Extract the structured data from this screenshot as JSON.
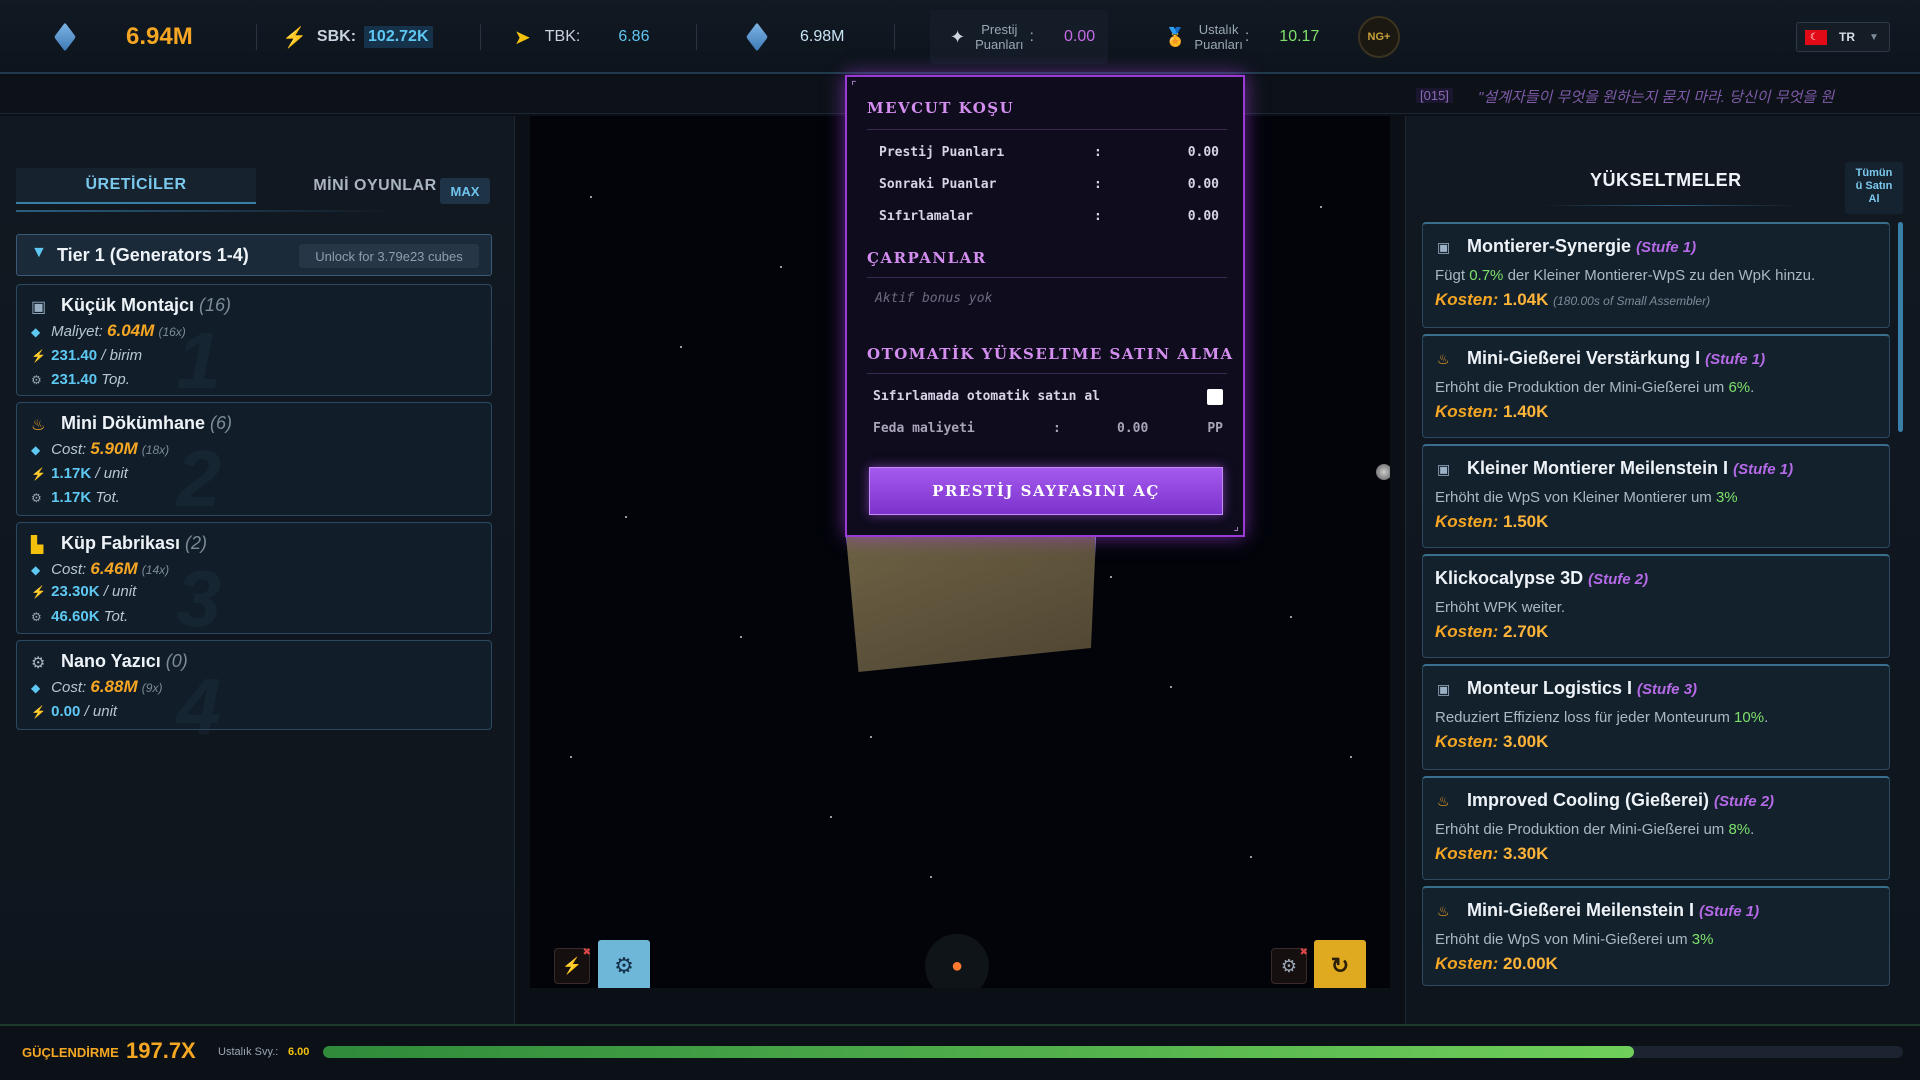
{
  "topbar": {
    "cubes": "6.94M",
    "sbk_label": "SBK:",
    "sbk_value": "102.72K",
    "tbk_label": "TBK:",
    "tbk_value": "6.86",
    "total_cubes": "6.98M",
    "prestige_label_1": "Prestij",
    "prestige_label_2": "Puanları",
    "prestige_colon": ":",
    "prestige_value": "0.00",
    "mastery_label_1": "Ustalık",
    "mastery_label_2": "Puanları",
    "mastery_colon": ":",
    "mastery_value": "10.17",
    "ng_badge": "NG+",
    "language": "TR",
    "colors": {
      "accent_orange": "#f5a623",
      "accent_cyan": "#5ec8f2",
      "accent_green": "#7ee06a",
      "accent_purple": "#b66ae8"
    }
  },
  "ticker": {
    "code": "[015]",
    "text": "\"설계자들이 무엇을 원하는지 묻지 마라. 당신이 무엇을 원"
  },
  "left": {
    "tabs": [
      {
        "label": "ÜRETİCİLER",
        "active": true
      },
      {
        "label": "MİNİ OYUNLAR",
        "active": false
      }
    ],
    "max_button": "MAX",
    "tier": {
      "label": "Tier 1 (Generators 1-4)",
      "unlock": "Unlock for 3.79e23 cubes"
    },
    "generators": [
      {
        "name": "Küçük Montajcı",
        "count": "(16)",
        "cost_label": "Maliyet:",
        "cost": "6.04M",
        "mult": "(16x)",
        "rate": "231.40",
        "rate_unit": "/ birim",
        "total": "231.40",
        "total_unit": "Top.",
        "bignum": "1"
      },
      {
        "name": "Mini Dökümhane",
        "count": "(6)",
        "cost_label": "Cost:",
        "cost": "5.90M",
        "mult": "(18x)",
        "rate": "1.17K",
        "rate_unit": "/ unit",
        "total": "1.17K",
        "total_unit": "Tot.",
        "bignum": "2"
      },
      {
        "name": "Küp Fabrikası",
        "count": "(2)",
        "cost_label": "Cost:",
        "cost": "6.46M",
        "mult": "(14x)",
        "rate": "23.30K",
        "rate_unit": "/ unit",
        "total": "46.60K",
        "total_unit": "Tot.",
        "bignum": "3"
      },
      {
        "name": "Nano Yazıcı",
        "count": "(0)",
        "cost_label": "Cost:",
        "cost": "6.88M",
        "mult": "(9x)",
        "rate": "0.00",
        "rate_unit": "/ unit",
        "bignum": "4"
      }
    ]
  },
  "modal": {
    "current_run_title": "MEVCUT KOŞU",
    "rows": [
      {
        "label": "Prestij Puanları",
        "colon": ":",
        "value": "0.00"
      },
      {
        "label": "Sonraki Puanlar",
        "colon": ":",
        "value": "0.00"
      },
      {
        "label": "Sıfırlamalar",
        "colon": ":",
        "value": "0.00"
      }
    ],
    "multipliers_title": "ÇARPANLAR",
    "no_bonus": "Aktif bonus yok",
    "auto_title": "OTOMATİK YÜKSELTME SATIN ALMA",
    "auto_label": "Sıfırlamada otomatik satın al",
    "sacrifice_label": "Feda maliyeti",
    "sacrifice_colon": ":",
    "sacrifice_value": "0.00",
    "sacrifice_unit": "PP",
    "open_button": "PRESTİJ SAYFASINI AÇ"
  },
  "right": {
    "title": "YÜKSELTMELER",
    "buy_all": [
      "Tümün",
      "ü Satın",
      "Al"
    ],
    "upgrades": [
      {
        "name": "Montierer-Synergie",
        "stage": "(Stufe 1)",
        "desc_pre": "Fügt",
        "desc_hl": "0.7%",
        "desc_post": "der Kleiner Montierer-WpS zu den WpK hinzu.",
        "cost_label": "Kosten:",
        "cost": "1.04K",
        "cost_note": "(180.00s of Small Assembler)",
        "icon": "monitor-icon"
      },
      {
        "name": "Mini-Gießerei Verstärkung I",
        "stage": "(Stufe 1)",
        "desc_pre": "Erhöht die Produktion der Mini-Gießerei um",
        "desc_hl": "6%",
        "desc_post": ".",
        "cost_label": "Kosten:",
        "cost": "1.40K",
        "icon": "flask-icon"
      },
      {
        "name": "Kleiner Montierer Meilenstein I",
        "stage": "(Stufe 1)",
        "desc_pre": "Erhöht die WpS von Kleiner Montierer um",
        "desc_hl": "3%",
        "desc_post": "",
        "cost_label": "Kosten:",
        "cost": "1.50K",
        "icon": "monitor-icon"
      },
      {
        "name": "Klickocalypse 3D",
        "stage": "(Stufe 2)",
        "desc_pre": "Erhöht WPK weiter.",
        "desc_hl": "",
        "desc_post": "",
        "cost_label": "Kosten:",
        "cost": "2.70K",
        "icon": ""
      },
      {
        "name": "Monteur Logistics I",
        "stage": "(Stufe 3)",
        "desc_pre": "Reduziert Effizienz loss für jeder Monteurum",
        "desc_hl": "10%",
        "desc_post": ".",
        "cost_label": "Kosten:",
        "cost": "3.00K",
        "icon": "monitor-icon"
      },
      {
        "name": "Improved Cooling (Gießerei)",
        "stage": "(Stufe 2)",
        "desc_pre": "Erhöht die Produktion der Mini-Gießerei um",
        "desc_hl": "8%",
        "desc_post": ".",
        "cost_label": "Kosten:",
        "cost": "3.30K",
        "icon": "flask-icon"
      },
      {
        "name": "Mini-Gießerei Meilenstein I",
        "stage": "(Stufe 1)",
        "desc_pre": "Erhöht die WpS von Mini-Gießerei um",
        "desc_hl": "3%",
        "desc_post": "",
        "cost_label": "Kosten:",
        "cost": "20.00K",
        "icon": "flask-icon"
      }
    ]
  },
  "bottom": {
    "boost_label": "GÜÇLENDİRME",
    "boost_value": "197.7X",
    "mastery_level_label": "Ustalık Svy.:",
    "mastery_level_value": "6.00",
    "progress_fraction": 0.83
  }
}
